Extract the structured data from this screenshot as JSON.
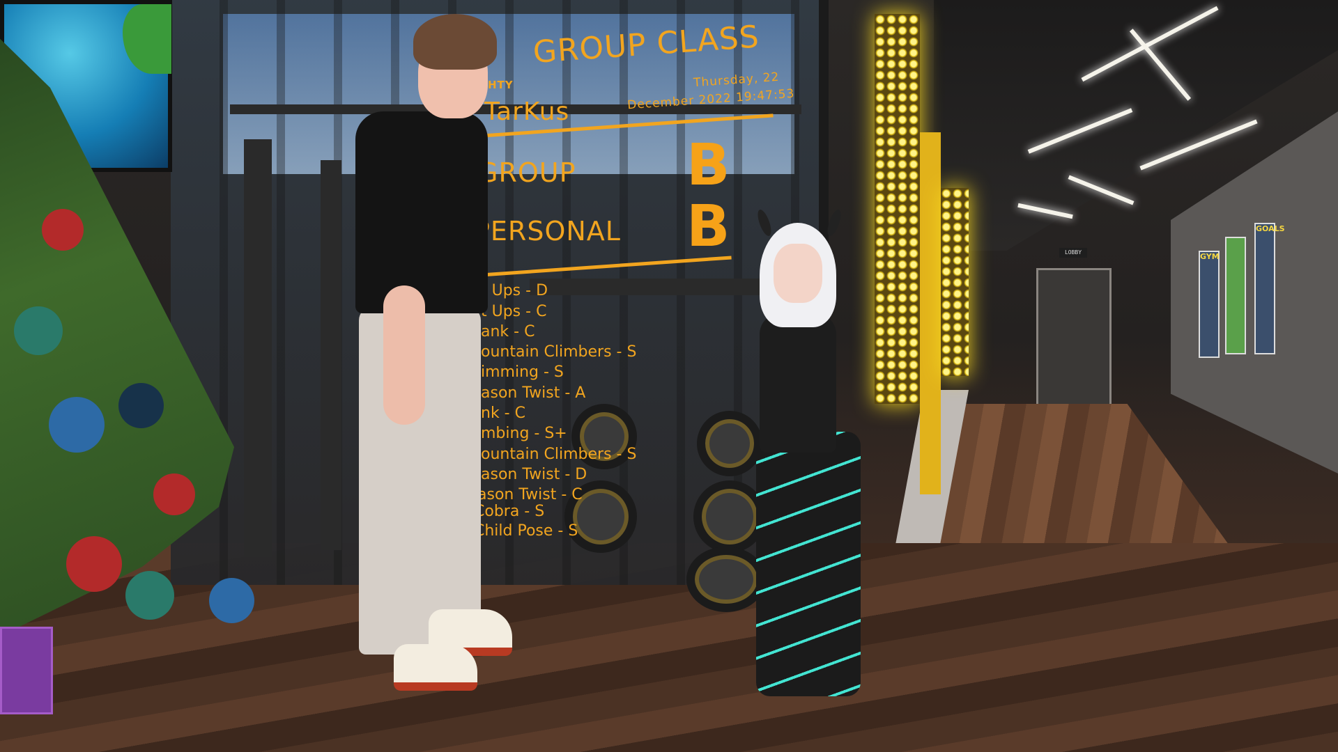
{
  "sign": {
    "logo": "HTY",
    "title": "GROUP CLASS",
    "name": "TarKus",
    "date_line1": "Thursday, 22",
    "date_line2": "December 2022 19:47:53",
    "group_label": "GROUP",
    "group_grade": "B",
    "personal_label": "PERSONAL",
    "personal_grade": "B",
    "exercises": [
      "t Ups - D",
      "t Ups - C",
      "ank - C",
      "ountain Climbers - S",
      "imming - S",
      "ason Twist - A",
      "nk - C",
      "mbing - S+",
      "ountain Climbers - S",
      "ason Twist - D",
      "ason Twist - C",
      "Cobra - S",
      "Child Pose - S"
    ]
  },
  "corridor": {
    "lobby_sign": "LOBBY",
    "posters": [
      "GYM",
      "GOALS"
    ]
  },
  "colors": {
    "sign_orange": "#f2a51f",
    "star_yellow": "#f4d420"
  }
}
